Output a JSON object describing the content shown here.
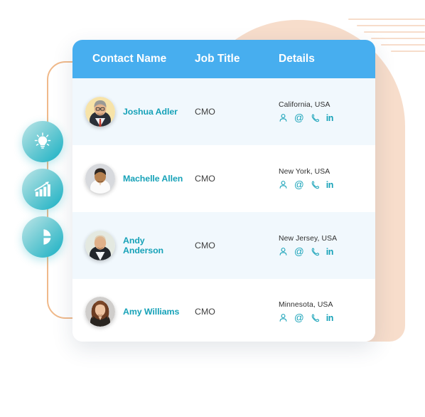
{
  "decor": {
    "blob_color": "#f7ddcb",
    "bracket_color": "#f0b98a",
    "stripe_count": 6
  },
  "rail": {
    "items": [
      {
        "icon": "lightbulb-icon",
        "name": "idea"
      },
      {
        "icon": "growth-chart-icon",
        "name": "growth"
      },
      {
        "icon": "pie-chart-icon",
        "name": "analytics"
      }
    ],
    "accent": "#17b0c4"
  },
  "table": {
    "header_bg": "#47aeef",
    "accent": "#17a2b8",
    "alt_row_bg": "#f1f8fd",
    "columns": [
      {
        "key": "name",
        "label": "Contact Name"
      },
      {
        "key": "title",
        "label": "Job Title"
      },
      {
        "key": "details",
        "label": "Details"
      }
    ],
    "detail_icons": [
      {
        "name": "person-icon",
        "glyph": "person"
      },
      {
        "name": "email-icon",
        "glyph": "@"
      },
      {
        "name": "phone-icon",
        "glyph": "phone"
      },
      {
        "name": "linkedin-icon",
        "glyph": "in"
      }
    ],
    "rows": [
      {
        "name": "Joshua Adler",
        "title": "CMO",
        "location": "California, USA",
        "avatar": "avatar-joshua-adler"
      },
      {
        "name": "Machelle Allen",
        "title": "CMO",
        "location": "New York, USA",
        "avatar": "avatar-machelle-allen"
      },
      {
        "name": "Andy Anderson",
        "title": "CMO",
        "location": "New Jersey, USA",
        "avatar": "avatar-andy-anderson"
      },
      {
        "name": "Amy Williams",
        "title": "CMO",
        "location": "Minnesota, USA",
        "avatar": "avatar-amy-williams"
      }
    ]
  }
}
